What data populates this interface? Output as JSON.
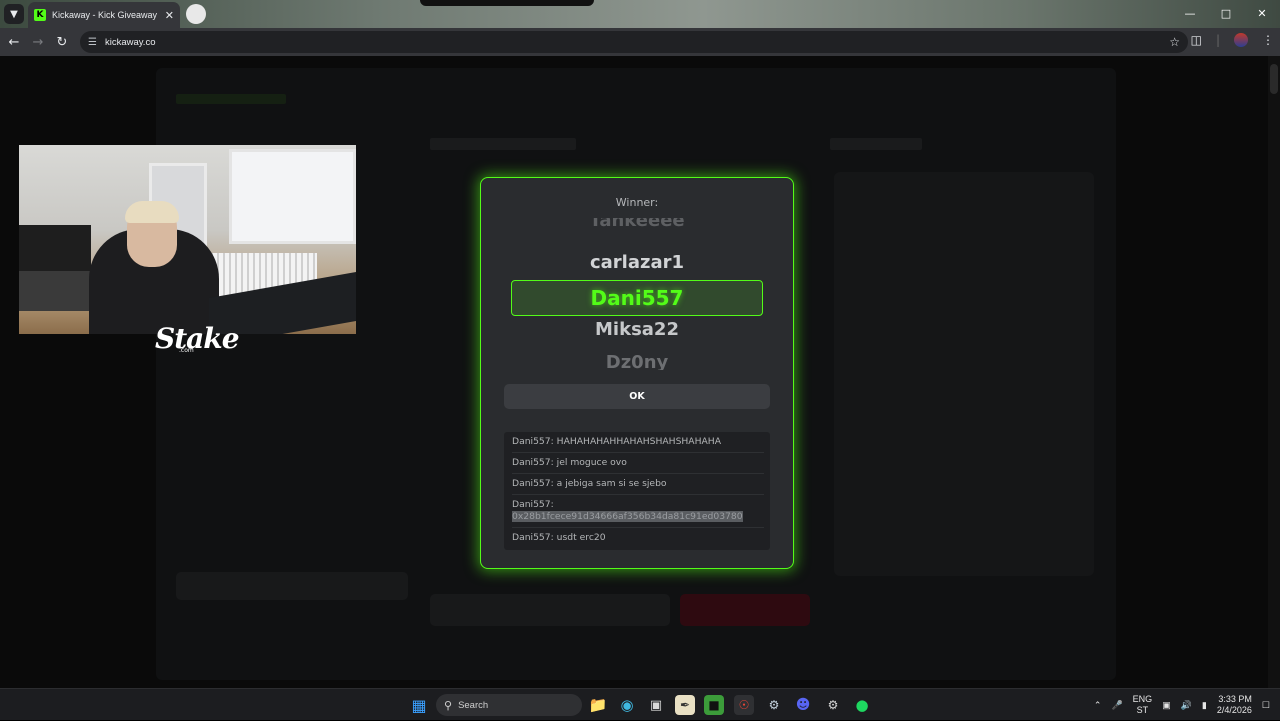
{
  "browser": {
    "tab_title": "Kickaway - Kick Giveaway Tool",
    "url": "kickaway.co"
  },
  "overlay": {
    "logo_text": "Stake",
    "logo_sub": ".com"
  },
  "modal": {
    "winner_label": "Winner:",
    "reel_names": [
      "Tankeeee",
      "carlazar1",
      "Dani557",
      "Miksa22",
      "Dz0ny"
    ],
    "winner": "Dani557",
    "ok_label": "OK",
    "chat": [
      {
        "user": "Dani557",
        "text": "HAHAHAHAHHAHAHSHAHSHAHAHA"
      },
      {
        "user": "Dani557",
        "text": "jel moguce ovo"
      },
      {
        "user": "Dani557",
        "text": "a jebiga sam si se sjebo"
      },
      {
        "user": "Dani557",
        "text": "0x28b1fcece91d34666af356b34da81c91ed03780",
        "highlighted": true
      },
      {
        "user": "Dani557",
        "text": "usdt erc20"
      }
    ]
  },
  "taskbar": {
    "search_placeholder": "Search",
    "lang_top": "ENG",
    "lang_bottom": "ST",
    "time": "3:33 PM",
    "date": "2/4/2026"
  },
  "colors": {
    "accent": "#53fc18",
    "modal_bg": "#2a2c2f"
  }
}
